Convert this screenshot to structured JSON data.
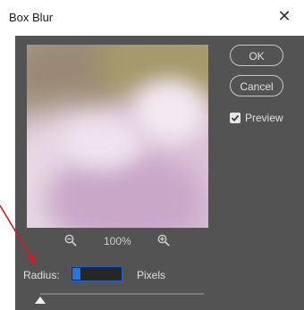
{
  "window": {
    "title": "Box Blur"
  },
  "preview": {
    "zoom_level": "100%"
  },
  "buttons": {
    "ok_label": "OK",
    "cancel_label": "Cancel"
  },
  "preview_toggle": {
    "label": "Preview",
    "checked": true
  },
  "radius": {
    "label": "Radius:",
    "value": "7",
    "unit": "Pixels"
  },
  "icons": {
    "close": "close-icon",
    "zoom_out": "zoom-out-icon",
    "zoom_in": "zoom-in-icon",
    "checkbox": "checkmark-icon",
    "slider_thumb": "slider-thumb-icon"
  },
  "colors": {
    "dialog_bg": "#535353",
    "input_focus": "#1f62c3",
    "annotation_arrow": "#cc1f1f"
  }
}
